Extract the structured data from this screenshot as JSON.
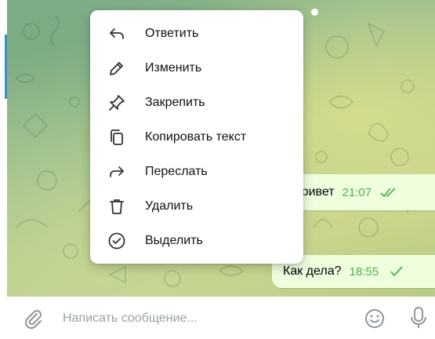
{
  "context_menu": {
    "items": [
      {
        "label": "Ответить",
        "icon": "reply-icon"
      },
      {
        "label": "Изменить",
        "icon": "pencil-icon"
      },
      {
        "label": "Закрепить",
        "icon": "pin-icon"
      },
      {
        "label": "Копировать текст",
        "icon": "copy-icon"
      },
      {
        "label": "Переслать",
        "icon": "forward-icon"
      },
      {
        "label": "Удалить",
        "icon": "trash-icon"
      },
      {
        "label": "Выделить",
        "icon": "select-circle-icon"
      }
    ]
  },
  "messages": [
    {
      "text": "привет",
      "time": "21:07",
      "status": "read"
    },
    {
      "text": "Как дела?",
      "time": "18:55",
      "status": "sent"
    }
  ],
  "composer": {
    "placeholder": "Написать сообщение...",
    "icons": [
      "paperclip-icon",
      "emoji-icon",
      "microphone-icon"
    ]
  },
  "colors": {
    "bubble_bg": "#efffde",
    "time_text": "#4fae4e",
    "accent": "#3a8fd1"
  }
}
